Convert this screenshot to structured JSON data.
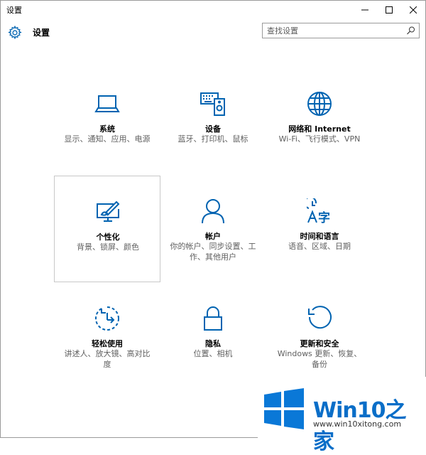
{
  "window": {
    "title": "设置",
    "controls": {
      "minimize_icon": "minimize-icon",
      "maximize_icon": "maximize-icon",
      "close_icon": "close-icon"
    }
  },
  "header": {
    "icon": "gear-icon",
    "title": "设置",
    "search": {
      "placeholder": "查找设置",
      "value": "",
      "icon": "search-icon"
    }
  },
  "tiles": [
    {
      "id": "system",
      "icon": "laptop-icon",
      "title": "系统",
      "desc": "显示、通知、应用、电源"
    },
    {
      "id": "devices",
      "icon": "keyboard-speaker-icon",
      "title": "设备",
      "desc": "蓝牙、打印机、鼠标"
    },
    {
      "id": "network",
      "icon": "globe-icon",
      "title": "网络和 Internet",
      "desc": "Wi-Fi、飞行模式、VPN"
    },
    {
      "id": "personalization",
      "icon": "paint-monitor-icon",
      "title": "个性化",
      "desc": "背景、锁屏、颜色"
    },
    {
      "id": "accounts",
      "icon": "person-icon",
      "title": "帐户",
      "desc": "你的帐户、同步设置、工作、其他用户"
    },
    {
      "id": "time-language",
      "icon": "time-language-icon",
      "title": "时间和语言",
      "desc": "语音、区域、日期"
    },
    {
      "id": "ease-of-access",
      "icon": "ease-of-access-icon",
      "title": "轻松使用",
      "desc": "讲述人、放大镜、高对比度"
    },
    {
      "id": "privacy",
      "icon": "lock-icon",
      "title": "隐私",
      "desc": "位置、相机"
    },
    {
      "id": "update-security",
      "icon": "update-icon",
      "title": "更新和安全",
      "desc": "Windows 更新、恢复、备份"
    }
  ],
  "selected_tile": "personalization",
  "accent_color": "#0063b1",
  "watermark": {
    "brand": "Win10之家",
    "url": "www.win10xitong.com",
    "logo": "windows-logo-icon"
  }
}
